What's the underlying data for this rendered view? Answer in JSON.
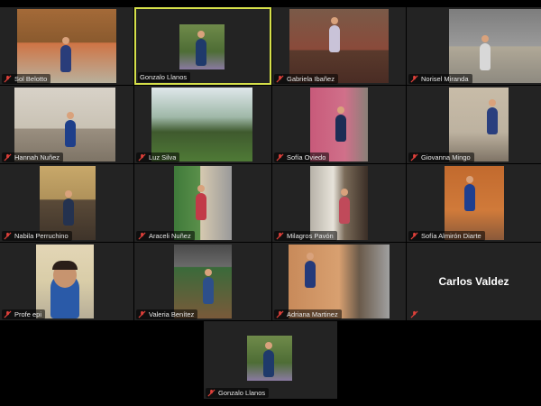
{
  "participants": [
    {
      "name": "Sol Belotto",
      "muted": true
    },
    {
      "name": "Gonzalo Llanos",
      "muted": false,
      "active_speaker": true
    },
    {
      "name": "Gabriela Ibañez",
      "muted": true
    },
    {
      "name": "Norisel Miranda",
      "muted": true
    },
    {
      "name": "Hannah Nuñez",
      "muted": true
    },
    {
      "name": "Luz Silva",
      "muted": true
    },
    {
      "name": "Sofía Oviedo",
      "muted": true
    },
    {
      "name": "Giovanna Mingo",
      "muted": true
    },
    {
      "name": "Nabila Perruchino",
      "muted": true
    },
    {
      "name": "Araceli Nuñez",
      "muted": true
    },
    {
      "name": "Milagros Pavón",
      "muted": true
    },
    {
      "name": "Sofía Almirón Diarte",
      "muted": true
    },
    {
      "name": "Profe epi",
      "muted": true
    },
    {
      "name": "Valeria Benítez",
      "muted": true
    },
    {
      "name": "Adriana Martinez",
      "muted": true
    },
    {
      "name": "Carlos Valdez",
      "muted": true,
      "video_off": true
    },
    {
      "name": "Gonzalo Llanos",
      "muted": true
    }
  ],
  "colors": {
    "active_border": "#d6e04a",
    "muted_icon": "#e0403a",
    "tile_bg": "#232323"
  },
  "icons": {
    "muted": "mic-off-icon"
  }
}
